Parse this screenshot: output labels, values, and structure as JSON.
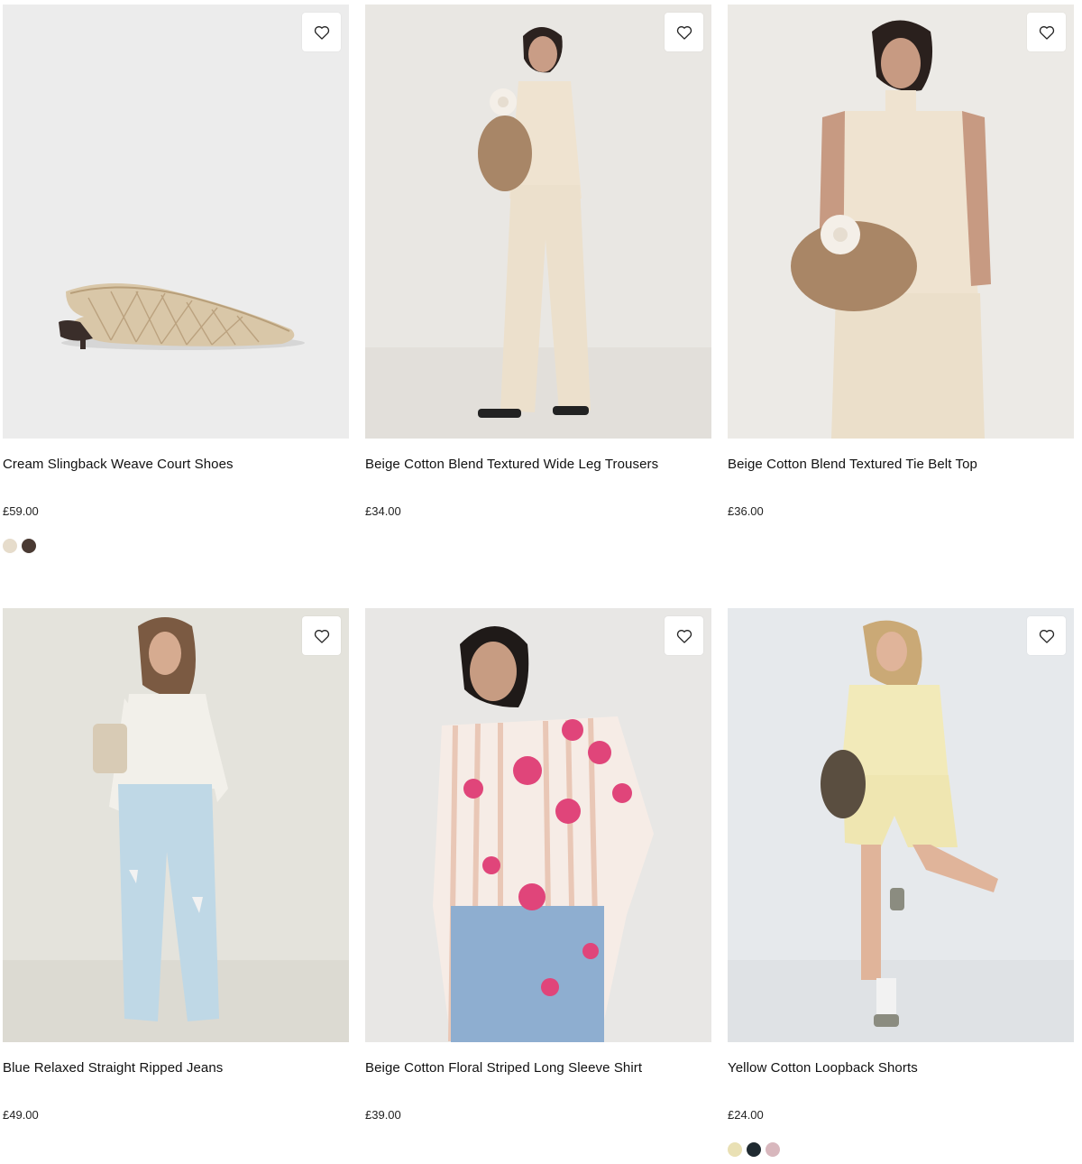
{
  "products": [
    {
      "name": "Cream Slingback Weave Court Shoes",
      "price": "£59.00",
      "image": "woven-slingback-shoe",
      "swatches": [
        "#e6dccb",
        "#4a3a33"
      ]
    },
    {
      "name": "Beige Cotton Blend Textured Wide Leg Trousers",
      "price": "£34.00",
      "image": "model-beige-wide-leg-trousers",
      "swatches": []
    },
    {
      "name": "Beige Cotton Blend Textured Tie Belt Top",
      "price": "£36.00",
      "image": "model-beige-tie-belt-top",
      "swatches": []
    },
    {
      "name": "Blue Relaxed Straight Ripped Jeans",
      "price": "£49.00",
      "image": "model-blue-ripped-jeans",
      "swatches": []
    },
    {
      "name": "Beige Cotton Floral Striped Long Sleeve Shirt",
      "price": "£39.00",
      "image": "model-floral-striped-shirt",
      "swatches": []
    },
    {
      "name": "Yellow Cotton Loopback Shorts",
      "price": "£24.00",
      "image": "model-yellow-loopback-shorts",
      "swatches": [
        "#e9e0b4",
        "#1f2a30",
        "#d8b7bd"
      ]
    }
  ],
  "icons": {
    "wishlist": "heart-outline-icon"
  }
}
